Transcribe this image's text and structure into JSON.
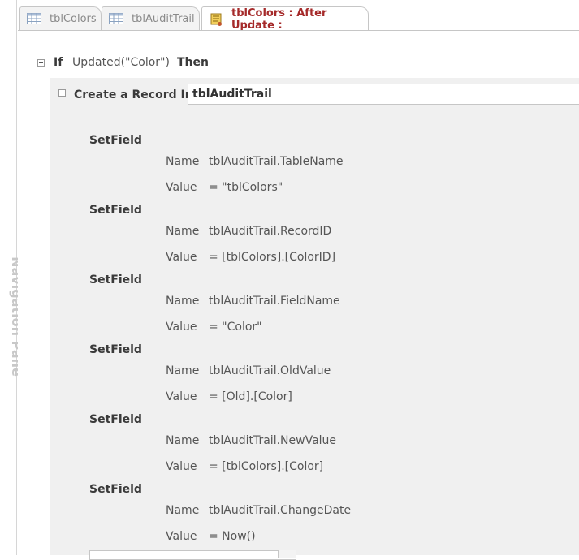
{
  "nav_pane": {
    "label": "Navigation Pane"
  },
  "tabs": [
    {
      "label": "tblColors",
      "icon": "table-icon"
    },
    {
      "label": "tblAuditTrail",
      "icon": "table-icon"
    },
    {
      "label": "tblColors : After Update :",
      "icon": "macro-icon",
      "active": true
    }
  ],
  "if_block": {
    "keyword_if": "If",
    "condition": "Updated(\"Color\")",
    "keyword_then": "Then"
  },
  "create_record": {
    "label": "Create a Record In",
    "table": "tblAuditTrail"
  },
  "setfields": [
    {
      "action": "SetField",
      "name_label": "Name",
      "name": "tblAuditTrail.TableName",
      "value_label": "Value",
      "value": "= \"tblColors\""
    },
    {
      "action": "SetField",
      "name_label": "Name",
      "name": "tblAuditTrail.RecordID",
      "value_label": "Value",
      "value": "= [tblColors].[ColorID]"
    },
    {
      "action": "SetField",
      "name_label": "Name",
      "name": "tblAuditTrail.FieldName",
      "value_label": "Value",
      "value": "= \"Color\""
    },
    {
      "action": "SetField",
      "name_label": "Name",
      "name": "tblAuditTrail.OldValue",
      "value_label": "Value",
      "value": "= [Old].[Color]"
    },
    {
      "action": "SetField",
      "name_label": "Name",
      "name": "tblAuditTrail.NewValue",
      "value_label": "Value",
      "value": "= [tblColors].[Color]"
    },
    {
      "action": "SetField",
      "name_label": "Name",
      "name": "tblAuditTrail.ChangeDate",
      "value_label": "Value",
      "value": "= Now()"
    }
  ],
  "colors": {
    "active_tab_text": "#a52a2a",
    "block_bg": "#f0f0f0"
  }
}
